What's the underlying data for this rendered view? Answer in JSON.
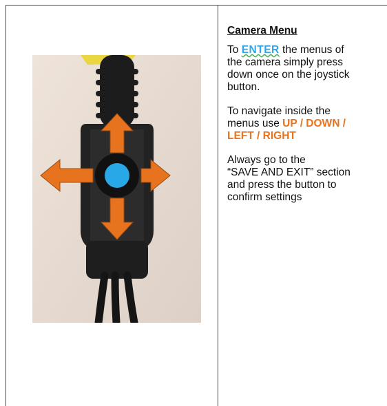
{
  "section": {
    "heading": "Camera Menu",
    "para1": {
      "before": "To",
      "enter": "ENTER",
      "after": "the menus of",
      "line2": "the camera simply press",
      "line3": "down once on the joystick",
      "line4": "button."
    },
    "para2": {
      "line1": "To navigate inside the",
      "line2_prefix": "menus use",
      "line2_highlight": "UP / DOWN /",
      "line3_highlight": "LEFT / RIGHT"
    },
    "para3": {
      "line1": "Always go to the",
      "line2": "“SAVE AND EXIT” section",
      "line3": "and press the button to",
      "line4": "confirm settings"
    }
  },
  "colors": {
    "enter": "#2ea6e8",
    "directions": "#e8731f",
    "arrow_fill": "#e8731f",
    "button_center": "#29a8e8",
    "cable": "#1a1a1a",
    "background_wall": "#e9ddd3"
  },
  "photo": {
    "arrows": [
      "up",
      "down",
      "left",
      "right"
    ]
  }
}
